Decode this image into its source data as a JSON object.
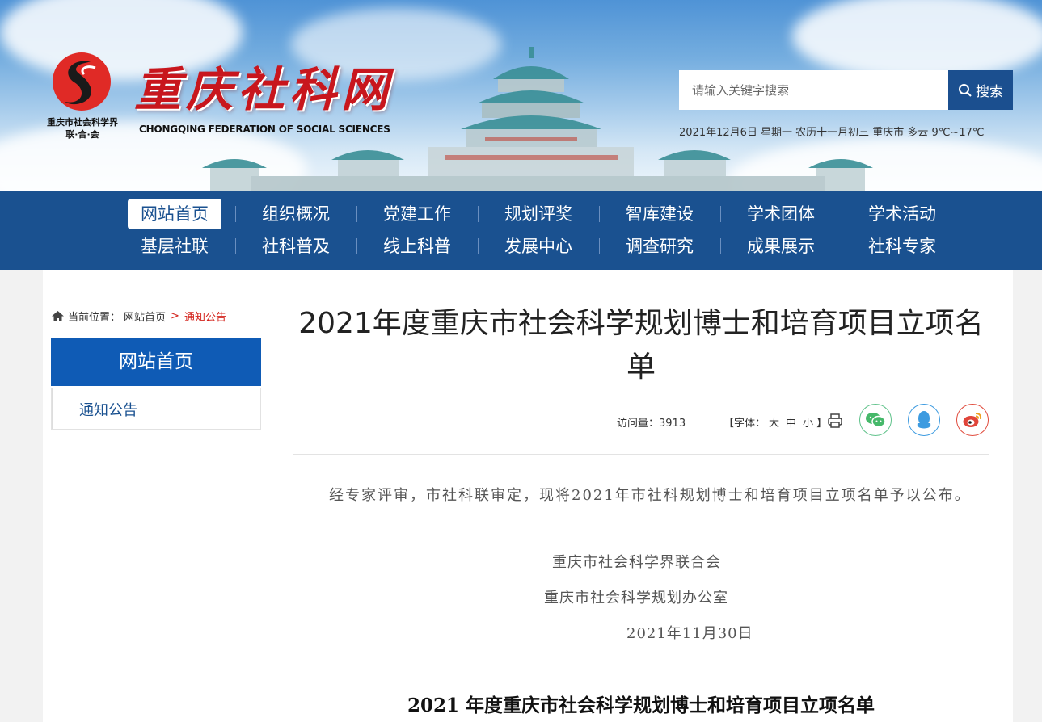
{
  "header": {
    "site_title": "重庆社科网",
    "org_name_line1": "重庆市社会科学界",
    "org_name_line2": "联·合·会",
    "subtitle": "CHONGQING FEDERATION OF SOCIAL SCIENCES",
    "search": {
      "placeholder": "请输入关键字搜索",
      "button_label": "搜索"
    },
    "weather": "2021年12月6日 星期一 农历十一月初三 重庆市 多云 9℃~17℃"
  },
  "nav": {
    "row1": [
      "网站首页",
      "组织概况",
      "党建工作",
      "规划评奖",
      "智库建设",
      "学术团体",
      "学术活动"
    ],
    "row2": [
      "基层社联",
      "社科普及",
      "线上科普",
      "发展中心",
      "调查研究",
      "成果展示",
      "社科专家"
    ],
    "active": "网站首页"
  },
  "breadcrumb": {
    "prefix": "当前位置：",
    "home": "网站首页",
    "separator": ">",
    "current": "通知公告"
  },
  "sidebar": {
    "heading": "网站首页",
    "items": [
      "通知公告"
    ]
  },
  "article": {
    "title": "2021年度重庆市社会科学规划博士和培育项目立项名单",
    "visits_label": "访问量：",
    "visits": "3913",
    "font_label": "【字体：",
    "font_sizes": [
      "大",
      "中",
      "小"
    ],
    "font_close": "】",
    "share_icons": [
      "wechat-icon",
      "qq-icon",
      "weibo-icon"
    ],
    "paragraph": "经专家评审，市社科联审定，现将2021年市社科规划博士和培育项目立项名单予以公布。",
    "signature_1": "重庆市社会科学界联合会",
    "signature_2": "重庆市社会科学规划办公室",
    "date": "2021年11月30日",
    "subtitle": "2021 年度重庆市社会科学规划博士和培育项目立项名单"
  },
  "colors": {
    "nav_bg": "#1a5190",
    "side_head_bg": "#0f5bb5",
    "crumb_current": "#d4251e",
    "brand_red": "#c8161d"
  }
}
